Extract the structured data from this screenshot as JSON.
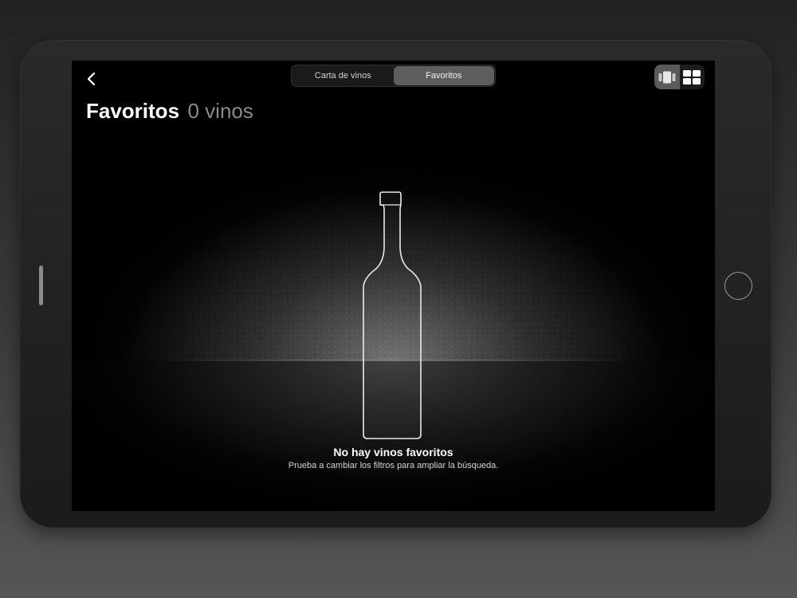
{
  "nav": {
    "back_icon": "chevron-left-icon",
    "tabs": [
      {
        "label": "Carta de vinos",
        "active": false
      },
      {
        "label": "Favoritos",
        "active": true
      }
    ],
    "view_modes": [
      {
        "icon": "carousel-view-icon",
        "active": true
      },
      {
        "icon": "grid-view-icon",
        "active": false
      }
    ]
  },
  "header": {
    "title": "Favoritos",
    "count": "0 vinos"
  },
  "empty_state": {
    "illustration": "wine-bottle-outline",
    "title": "No hay vinos favoritos",
    "subtitle": "Prueba a cambiar los filtros para ampliar la búsqueda."
  },
  "colors": {
    "background": "#000000",
    "segment_active": "#5e5e5e",
    "title": "#ffffff",
    "count": "#8a8a8a"
  }
}
